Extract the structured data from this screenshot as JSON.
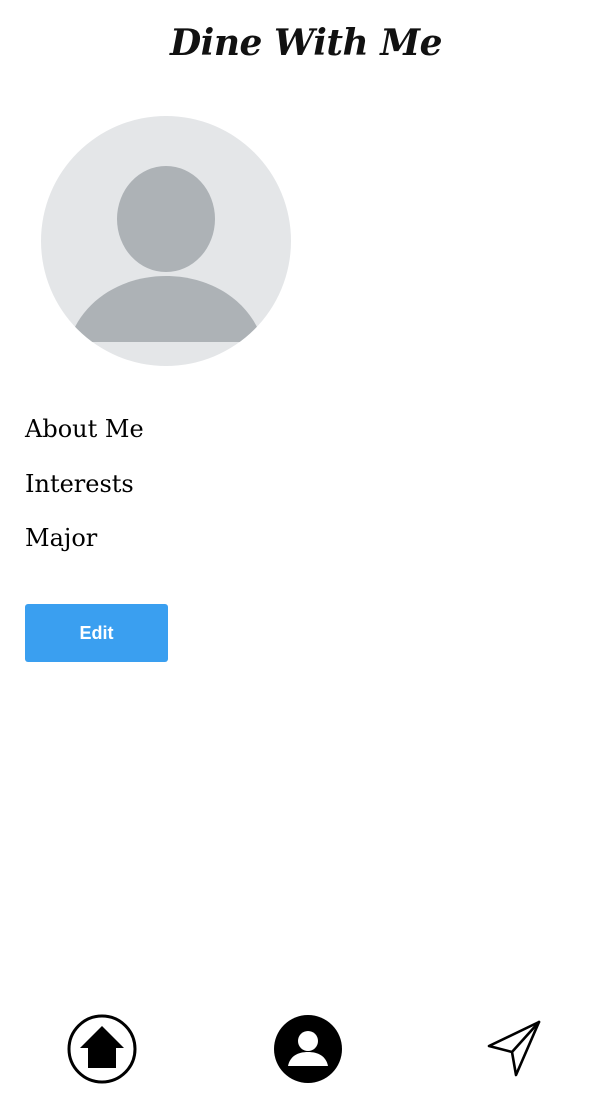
{
  "header": {
    "app_title": "Dine With Me"
  },
  "profile": {
    "avatar_icon": "default-user-avatar",
    "fields": [
      {
        "label": "About Me"
      },
      {
        "label": "Interests"
      },
      {
        "label": "Major"
      }
    ],
    "edit_label": "Edit"
  },
  "bottom_nav": {
    "items": [
      {
        "icon": "home-icon"
      },
      {
        "icon": "profile-icon"
      },
      {
        "icon": "send-icon"
      }
    ]
  },
  "colors": {
    "accent": "#3a9ff0",
    "avatar_background": "#e4e6e8",
    "avatar_figure": "#adb2b6"
  }
}
